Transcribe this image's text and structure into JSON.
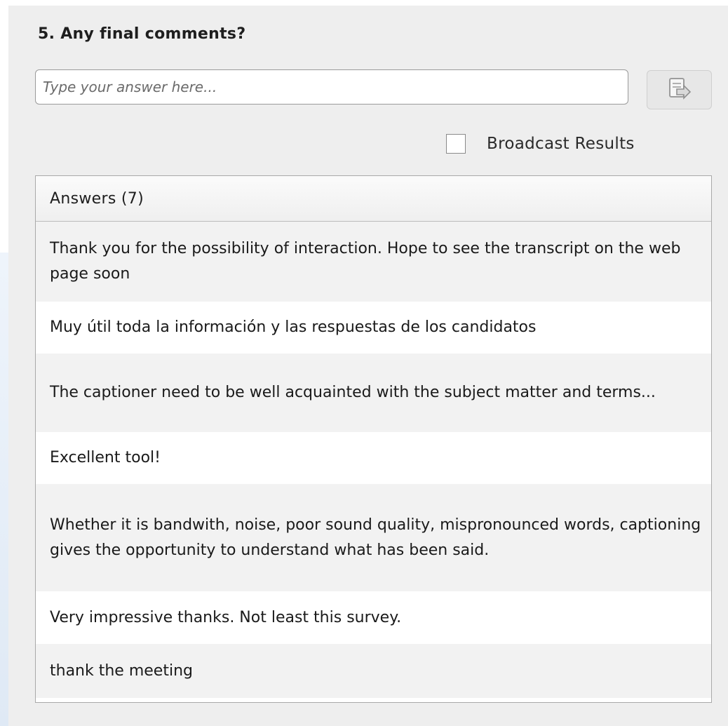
{
  "question": {
    "title": "5. Any final comments?"
  },
  "input": {
    "placeholder": "Type your answer here...",
    "value": ""
  },
  "submit": {
    "icon": "send-icon"
  },
  "broadcast": {
    "label": "Broadcast Results",
    "checked": false
  },
  "answers": {
    "header": "Answers (7)",
    "items": [
      "Thank you for the possibility of interaction. Hope to see the transcript on the web page soon",
      "Muy útil toda la información y las respuestas de los candidatos",
      "The captioner need to be well acquainted with the subject matter and terms...",
      "Excellent tool!",
      "Whether it is bandwith, noise, poor sound quality, mispronounced words, captioning gives the opportunity to understand what has been said.",
      "Very impressive thanks. Not least this survey.",
      "thank the meeting"
    ]
  }
}
